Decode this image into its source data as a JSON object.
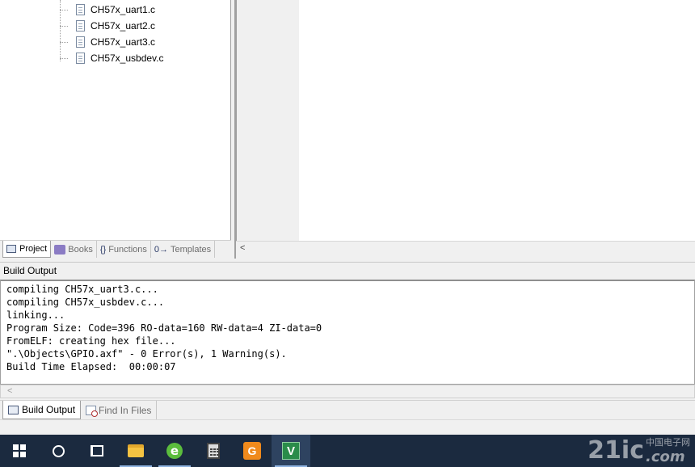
{
  "project_tree": {
    "files": [
      {
        "name": "CH57x_uart1.c",
        "icon": "c-file-icon"
      },
      {
        "name": "CH57x_uart2.c",
        "icon": "c-file-icon"
      },
      {
        "name": "CH57x_uart3.c",
        "icon": "c-file-icon"
      },
      {
        "name": "CH57x_usbdev.c",
        "icon": "c-file-icon"
      }
    ]
  },
  "left_tabs": {
    "project": "Project",
    "books": "Books",
    "functions": "Functions",
    "functions_icon": "{}",
    "templates": "Templates",
    "templates_icon": "0→"
  },
  "editor": {
    "scroll_left_arrow": "<"
  },
  "build_output": {
    "title": "Build Output",
    "lines": [
      "compiling CH57x_uart3.c...",
      "compiling CH57x_usbdev.c...",
      "linking...",
      "Program Size: Code=396 RO-data=160 RW-data=4 ZI-data=0",
      "FromELF: creating hex file...",
      "\".\\Objects\\GPIO.axf\" - 0 Error(s), 1 Warning(s).",
      "Build Time Elapsed:  00:00:07"
    ],
    "scroll_left_arrow": "<"
  },
  "bottom_tabs": {
    "build_output": "Build Output",
    "find_in_files": "Find In Files"
  },
  "taskbar": {
    "items": [
      {
        "name": "start-button",
        "icon": "windows-logo-icon"
      },
      {
        "name": "cortana-button",
        "icon": "circle-search-icon"
      },
      {
        "name": "task-view-button",
        "icon": "task-view-icon"
      },
      {
        "name": "file-explorer",
        "icon": "folder-icon"
      },
      {
        "name": "browser",
        "icon": "browser-e-icon",
        "glyph": "e"
      },
      {
        "name": "calculator",
        "icon": "calculator-icon"
      },
      {
        "name": "pdf-reader",
        "icon": "pdf-icon",
        "glyph": "G"
      },
      {
        "name": "keil-uvision",
        "icon": "keil-icon",
        "glyph": "V"
      }
    ]
  },
  "watermark": {
    "main": "21ic",
    "cn": "中国电子网",
    "com": ".com"
  },
  "colors": {
    "taskbar": "#1b2a3f",
    "panel_bg": "#f0f0f0",
    "editor_bg": "#ffffff"
  }
}
